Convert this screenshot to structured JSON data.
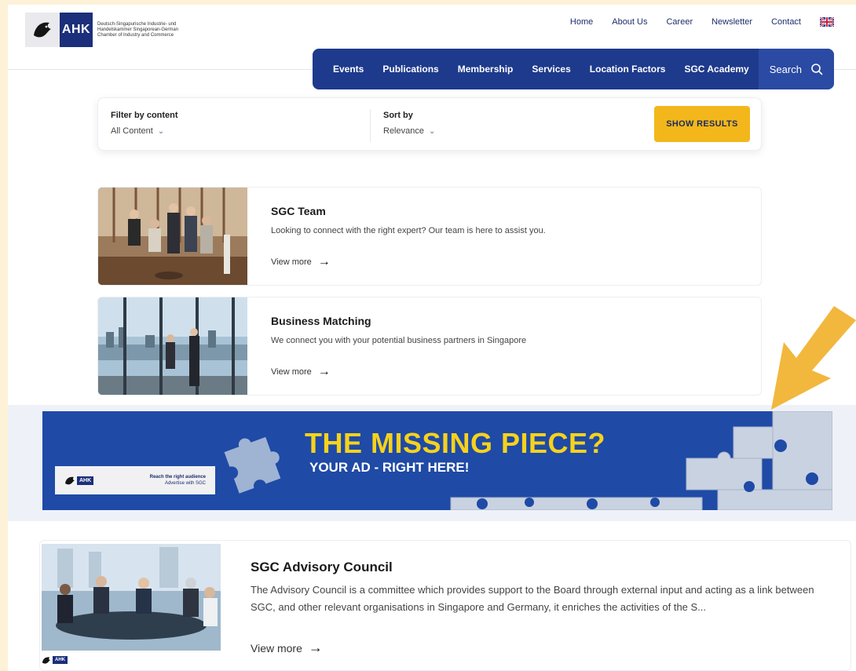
{
  "header": {
    "logo_text": "AHK",
    "logo_tagline": "Deutsch-Singapurische Industrie- und Handelskammer Singaporean-German Chamber of Industry and Commerce",
    "top_links": [
      "Home",
      "About Us",
      "Career",
      "Newsletter",
      "Contact"
    ],
    "main_nav": [
      "Events",
      "Publications",
      "Membership",
      "Services",
      "Location Factors",
      "SGC Academy"
    ],
    "search_label": "Search"
  },
  "filter": {
    "content_label": "Filter by content",
    "content_value": "All Content",
    "sort_label": "Sort by",
    "sort_value": "Relevance",
    "show_results": "SHOW RESULTS"
  },
  "cards": [
    {
      "title": "SGC Team",
      "description": "Looking to connect with the right expert? Our team is here to assist you.",
      "link": "View more"
    },
    {
      "title": "Business Matching",
      "description": "We connect you with your potential business partners in Singapore",
      "link": "View more"
    },
    {
      "title": "SGC Advisory Council",
      "description": "The Advisory Council is a committee which provides support to the Board through external input and acting as a link between SGC, and other relevant organisations in Singapore and Germany, it enriches the activities of the S...",
      "link": "View more"
    }
  ],
  "ad": {
    "headline": "THE MISSING PIECE?",
    "subheadline": "YOUR AD - RIGHT HERE!",
    "badge_logo": "AHK",
    "badge_line1": "Reach the right audience",
    "badge_line2": "Advertise with SGC"
  },
  "colors": {
    "nav_blue": "#1e3a8c",
    "accent_yellow": "#f3b71b",
    "ad_blue": "#1f4aa6",
    "ad_yellow": "#f6d21c",
    "arrow_orange": "#f2b73d",
    "outer_background": "#fdf2d8"
  }
}
